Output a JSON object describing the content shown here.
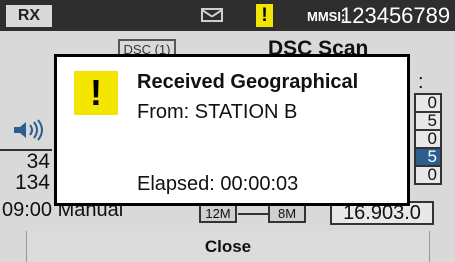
{
  "status_bar": {
    "rx_label": "RX",
    "mail_icon": "envelope-icon",
    "warning_icon": "warning-icon",
    "warning_glyph": "!",
    "mmsi_label": "MMSI:",
    "mmsi_value": "123456789"
  },
  "background": {
    "dsc_tag": "DSC (1)",
    "title": "DSC Scan",
    "colon": ":",
    "left_numbers": [
      "34",
      "134"
    ],
    "right_digits": [
      "0",
      "5",
      "0",
      "5",
      "0"
    ],
    "active_row_index": 3,
    "time_mode": "09:00 Manual",
    "size_tags": [
      "12M",
      "8M"
    ],
    "reading": "16.903.0",
    "speaker_icon": "speaker-icon"
  },
  "dialog": {
    "icon": "warning-icon",
    "icon_glyph": "!",
    "title": "Received Geographical",
    "from_line": "From: STATION B",
    "elapsed_line": "Elapsed: 00:00:03"
  },
  "footer": {
    "close_label": "Close"
  },
  "colors": {
    "warning_yellow": "#f2e600",
    "status_bar_bg": "#2e2e2e",
    "active_cell": "#2d5d8e"
  }
}
